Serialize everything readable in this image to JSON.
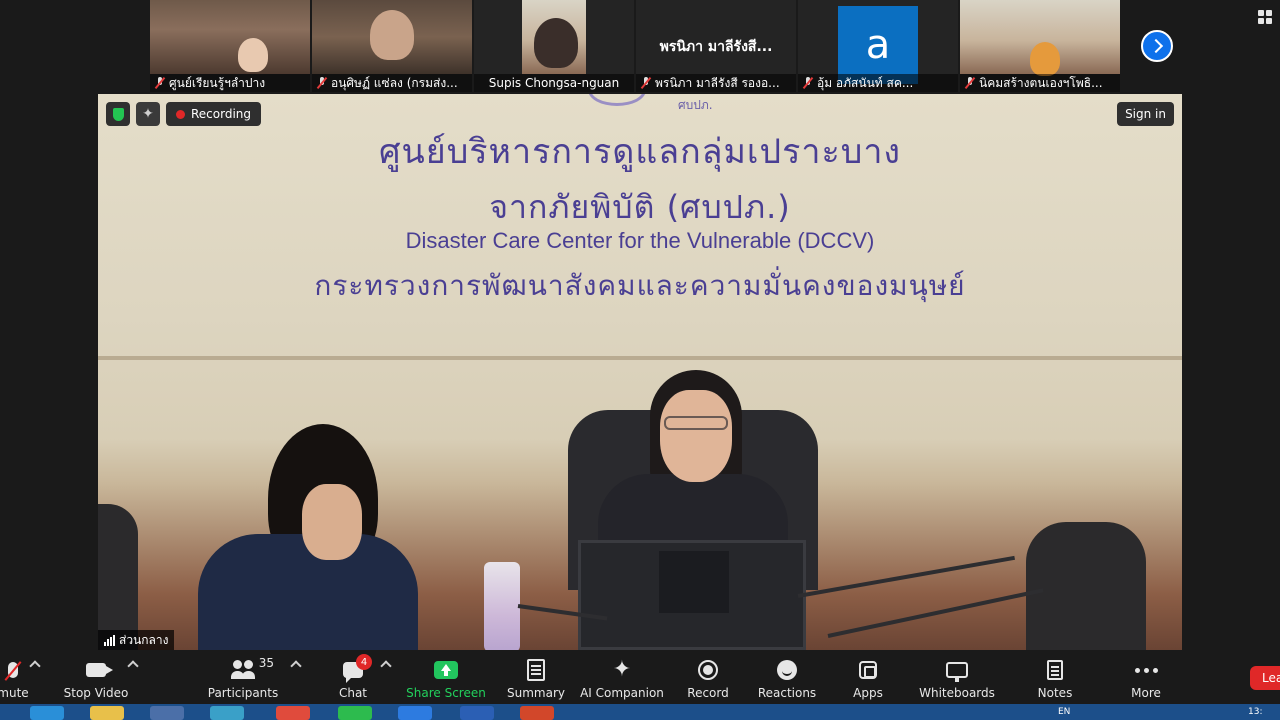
{
  "thumbnails": [
    {
      "name": "ศูนย์เรียนรู้ฯลำปาง",
      "muted": true,
      "kind": "room"
    },
    {
      "name": "อนุศิษฏ์  แซ่ลง (กรมส่ง...",
      "muted": true,
      "kind": "person"
    },
    {
      "name": "Supis Chongsa-nguan",
      "muted": false,
      "kind": "person"
    },
    {
      "name": "พรนิภา มาลีรังสี รองอ...",
      "center_name": "พรนิภา มาลีรังสี...",
      "muted": true,
      "kind": "name"
    },
    {
      "name": "อุ้ม อภัสนันท์ สค...",
      "avatar_letter": "a",
      "muted": true,
      "kind": "avatar"
    },
    {
      "name": "นิคมสร้างตนเองฯโพธิ...",
      "muted": true,
      "kind": "room"
    }
  ],
  "main_video": {
    "overlay": {
      "recording_label": "Recording",
      "sign_in_label": "Sign in"
    },
    "sign": {
      "abbrev": "ศบปภ.",
      "line1": "ศูนย์บริหารการดูแลกลุ่มเปราะบาง",
      "line2": "จากภัยพิบัติ (ศบปภ.)",
      "line3": "Disaster Care Center for the Vulnerable (DCCV)",
      "line4": "กระทรวงการพัฒนาสังคมและความมั่นคงของมนุษย์"
    },
    "speaker_name": "ส่วนกลาง"
  },
  "toolbar": {
    "items": [
      {
        "id": "mute",
        "label": "mute"
      },
      {
        "id": "video",
        "label": "Stop Video"
      },
      {
        "id": "participants",
        "label": "Participants",
        "count": "35"
      },
      {
        "id": "chat",
        "label": "Chat",
        "badge": "4"
      },
      {
        "id": "share",
        "label": "Share Screen"
      },
      {
        "id": "summary",
        "label": "Summary"
      },
      {
        "id": "ai",
        "label": "AI Companion"
      },
      {
        "id": "record",
        "label": "Record"
      },
      {
        "id": "reactions",
        "label": "Reactions"
      },
      {
        "id": "apps",
        "label": "Apps"
      },
      {
        "id": "whiteboards",
        "label": "Whiteboards"
      },
      {
        "id": "notes",
        "label": "Notes"
      },
      {
        "id": "more",
        "label": "More"
      }
    ],
    "leave_label": "Lea"
  },
  "taskbar": {
    "lang": "EN",
    "clock": "13:"
  },
  "colors": {
    "accent_blue": "#0e71eb",
    "share_green": "#22c55e",
    "record_red": "#e02828",
    "sign_text": "#4a3f93"
  }
}
